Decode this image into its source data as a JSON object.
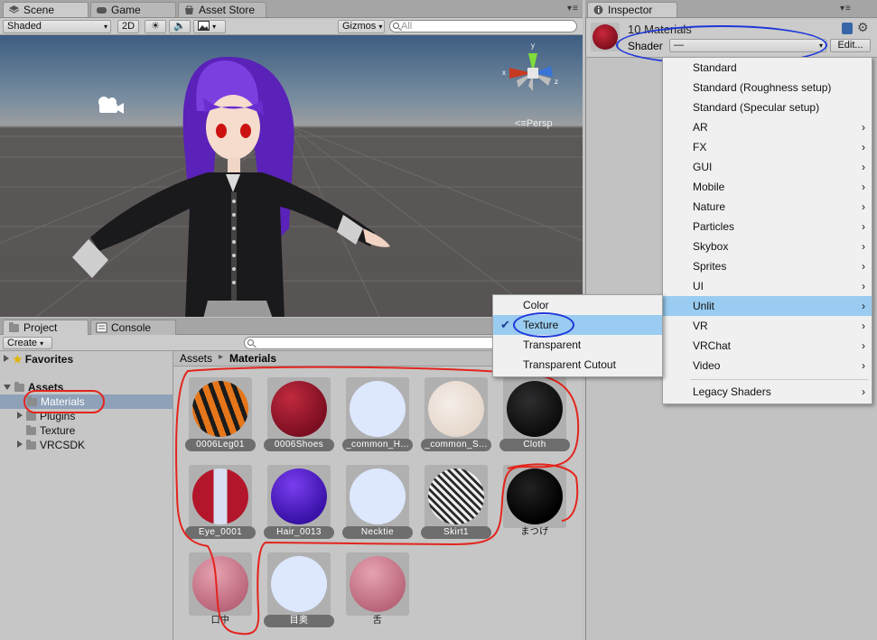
{
  "scene_tabs": {
    "scene": "Scene",
    "game": "Game",
    "asset_store": "Asset Store"
  },
  "scene_toolbar": {
    "shading": "Shaded",
    "mode_2d": "2D",
    "gizmos": "Gizmos",
    "search_placeholder": "All"
  },
  "viewport": {
    "projection": "Persp"
  },
  "inspector": {
    "tab": "Inspector",
    "title": "10 Materials",
    "shader_label": "Shader",
    "shader_value": "—",
    "edit_button": "Edit..."
  },
  "shader_menu": {
    "items": [
      "Standard",
      "Standard (Roughness setup)",
      "Standard (Specular setup)",
      "AR",
      "FX",
      "GUI",
      "Mobile",
      "Nature",
      "Particles",
      "Skybox",
      "Sprites",
      "UI",
      "Unlit",
      "VR",
      "VRChat",
      "Video"
    ],
    "footer": "Legacy Shaders",
    "highlighted": "Unlit"
  },
  "unlit_submenu": {
    "items": [
      "Color",
      "Texture",
      "Transparent",
      "Transparent Cutout"
    ],
    "checked": "Texture"
  },
  "project": {
    "tabs": {
      "project": "Project",
      "console": "Console"
    },
    "create": "Create",
    "favorites": "Favorites",
    "assets": "Assets",
    "tree": [
      "Materials",
      "Plugins",
      "Texture",
      "VRCSDK"
    ],
    "breadcrumb": {
      "root": "Assets",
      "separator": "▸",
      "current": "Materials"
    },
    "materials": [
      "0006Leg01",
      "0006Shoes",
      "_common_H...",
      "_common_S...",
      "Cloth",
      "Eye_0001",
      "Hair_0013",
      "Necktie",
      "Skirt1",
      "まつげ",
      "口中",
      "目奥",
      "舌"
    ]
  }
}
